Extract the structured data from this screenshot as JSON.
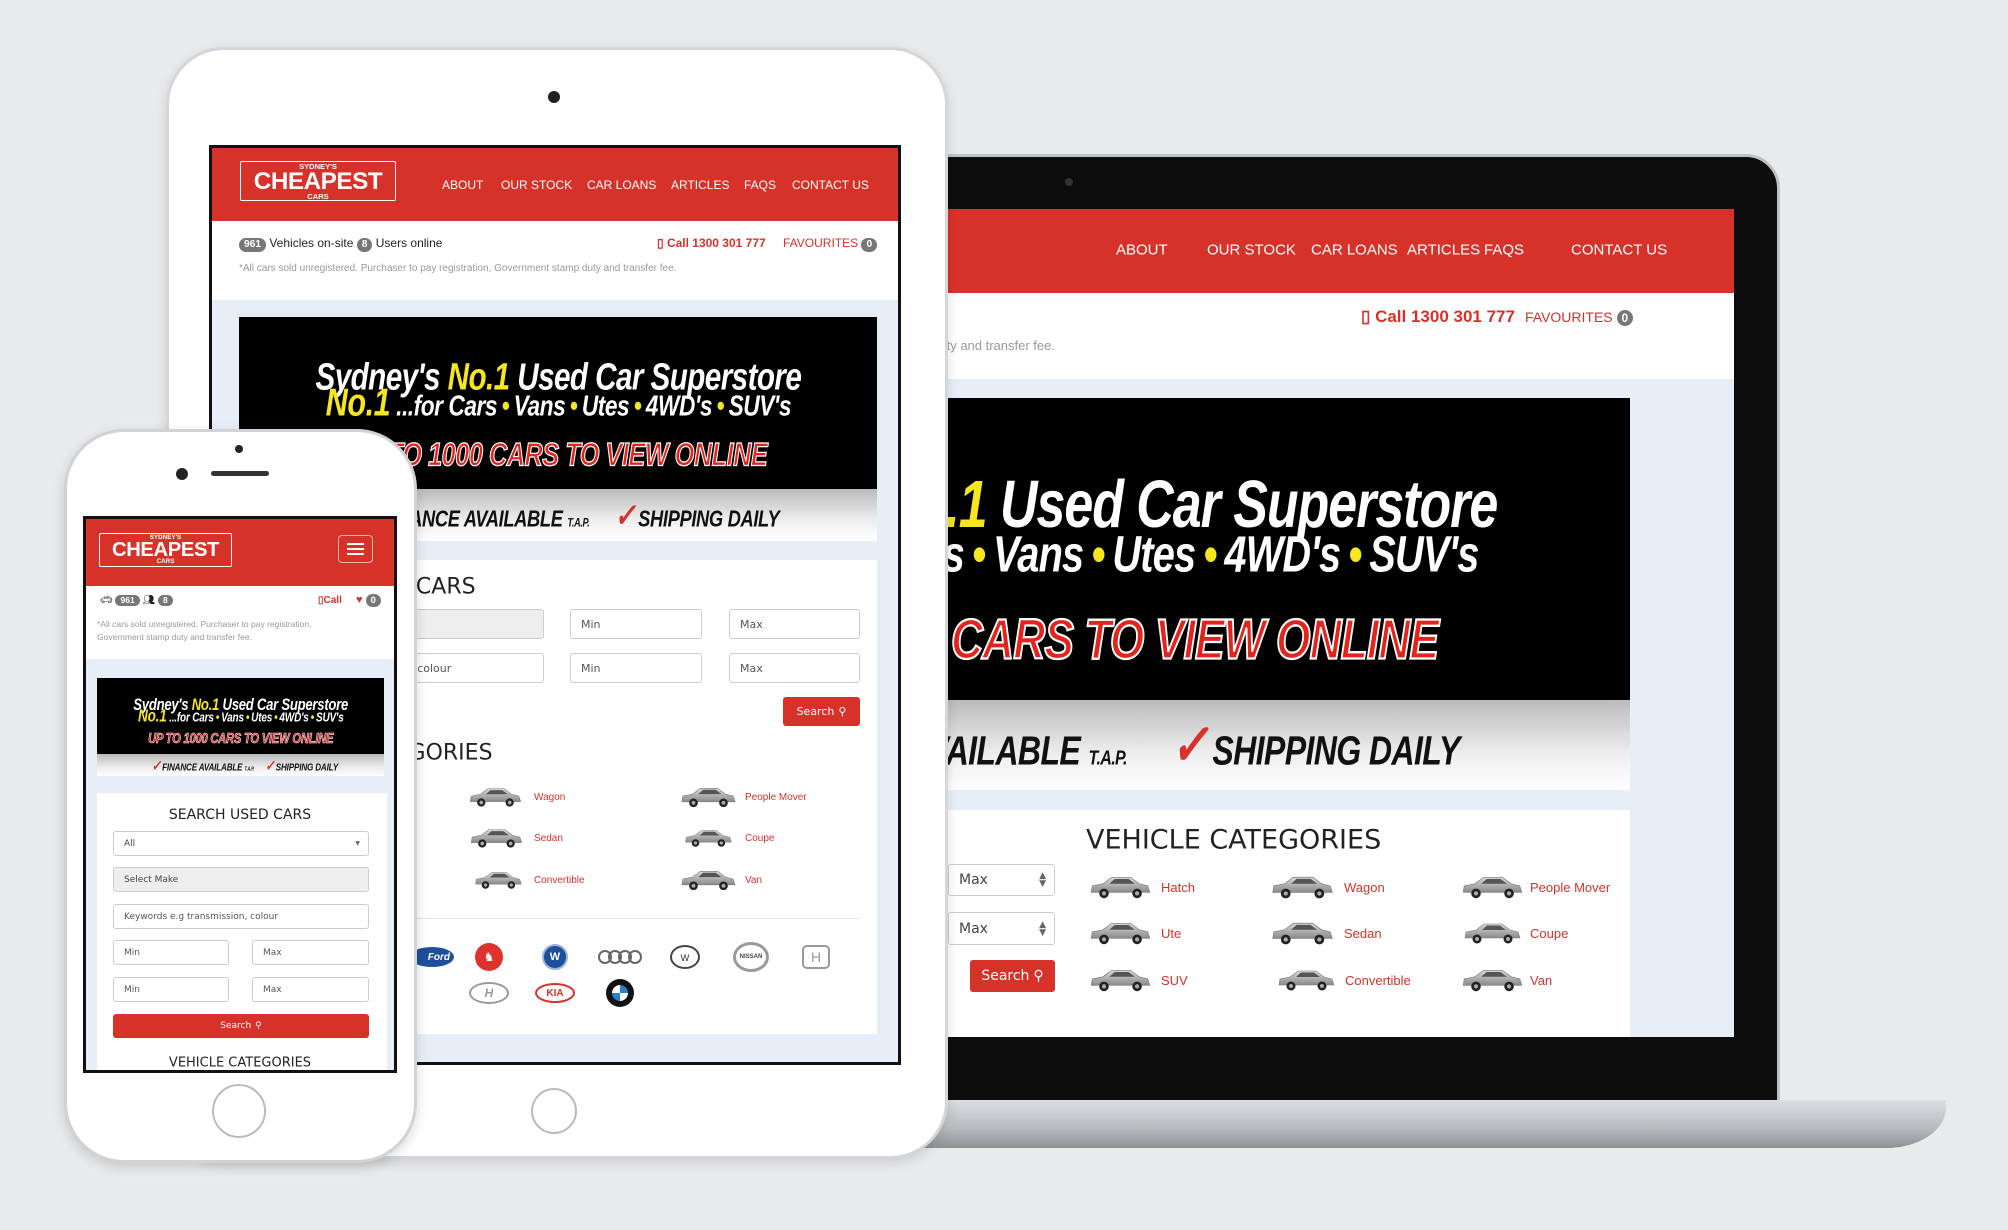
{
  "brand": {
    "logo_top": "SYDNEY'S",
    "logo_main": "CHEAPEST",
    "logo_bottom": "CARS"
  },
  "nav": [
    "ABOUT",
    "OUR STOCK",
    "CAR LOANS",
    "ARTICLES",
    "FAQS",
    "CONTACT US"
  ],
  "stats": {
    "vehicles": "961",
    "vehicles_label": "Vehicles on-site",
    "users": "8",
    "users_label": "Users online"
  },
  "contact": {
    "call": "Call 1300 301 777",
    "call_short": "Call",
    "favourites": "FAVOURITES",
    "favourites_count": "0"
  },
  "disclaimer": "*All cars sold unregistered. Purchaser to pay registration, Government stamp duty and transfer fee.",
  "disclaimer_mobile": [
    "*All cars sold unregistered. Purchaser to pay registration,",
    "Government stamp duty and transfer fee."
  ],
  "banner": {
    "l1a": "Sydney's",
    "no1": "No.1",
    "l1b": "Used Car Superstore",
    "l2": "...for Cars",
    "l2items": [
      "Vans",
      "Utes",
      "4WD's",
      "SUV's"
    ],
    "l3": "UP TO 1000 CARS TO VIEW ONLINE",
    "finance": "FINANCE AVAILABLE",
    "tap": "T.A.P.",
    "shipping": "SHIPPING DAILY"
  },
  "search": {
    "title": "SEARCH USED CARS",
    "type_value": "All",
    "make_value": "Select Make",
    "keywords_placeholder": "Keywords e.g transmission, colour",
    "min_placeholder": "Min",
    "max_placeholder": "Max",
    "max_value": "Max",
    "button": "Search"
  },
  "categories": {
    "title": "VEHICLE CATEGORIES",
    "items": [
      "Hatch",
      "Wagon",
      "People Mover",
      "Ute",
      "Sedan",
      "Coupe",
      "SUV",
      "Convertible",
      "Van"
    ]
  },
  "brands": [
    "Ford",
    "Holden",
    "Volkswagen",
    "Audi",
    "Mazda",
    "Nissan",
    "Honda",
    "Hyundai",
    "Kia",
    "BMW"
  ],
  "colors": {
    "brand_red": "#d7322a",
    "banner_yellow": "#f5e61d",
    "background": "#e9eaec",
    "content_bg": "#e8eef8"
  }
}
